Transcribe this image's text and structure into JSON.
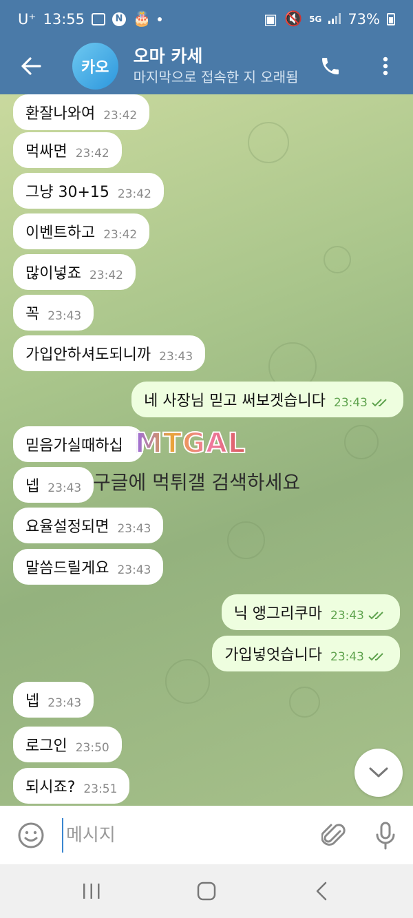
{
  "status_bar": {
    "carrier": "U⁺",
    "time": "13:55",
    "battery": "73%",
    "network": "5G"
  },
  "header": {
    "avatar_text": "카오",
    "title": "오마 카세",
    "subtitle": "마지막으로 접속한 지 오래됨"
  },
  "messages": [
    {
      "dir": "in",
      "text": "환잘나와여",
      "time": "23:42"
    },
    {
      "dir": "in",
      "text": "먹싸면",
      "time": "23:42"
    },
    {
      "dir": "in",
      "text": "그냥 30+15",
      "time": "23:42"
    },
    {
      "dir": "in",
      "text": "이벤트하고",
      "time": "23:42"
    },
    {
      "dir": "in",
      "text": "많이넣죠",
      "time": "23:42"
    },
    {
      "dir": "in",
      "text": "꼭",
      "time": "23:43"
    },
    {
      "dir": "in",
      "text": "가입안하셔도되니까",
      "time": "23:43"
    },
    {
      "dir": "out",
      "text": "네 사장님 믿고 써보겟습니다",
      "time": "23:43"
    },
    {
      "dir": "in",
      "text": "믿음가실때하십",
      "time": ""
    },
    {
      "dir": "in",
      "text": "넵",
      "time": "23:43"
    },
    {
      "dir": "in",
      "text": "요율설정되면",
      "time": "23:43"
    },
    {
      "dir": "in",
      "text": "말씀드릴게요",
      "time": "23:43"
    },
    {
      "dir": "out",
      "text": "닉 앵그리쿠마",
      "time": "23:43"
    },
    {
      "dir": "out",
      "text": "가입넣엇습니다",
      "time": "23:43"
    },
    {
      "dir": "in",
      "text": "넵",
      "time": "23:43"
    },
    {
      "dir": "in",
      "text": "로그인",
      "time": "23:50"
    },
    {
      "dir": "in",
      "text": "되시죠?",
      "time": "23:51"
    }
  ],
  "watermark": {
    "logo": "MTGAL",
    "text": "구글에 먹튀갤 검색하세요"
  },
  "input": {
    "placeholder": "메시지"
  },
  "colors": {
    "header": "#4a7aa8",
    "outgoing_bubble": "#eefedf",
    "incoming_bubble": "#ffffff",
    "read_check": "#5fa34e"
  }
}
